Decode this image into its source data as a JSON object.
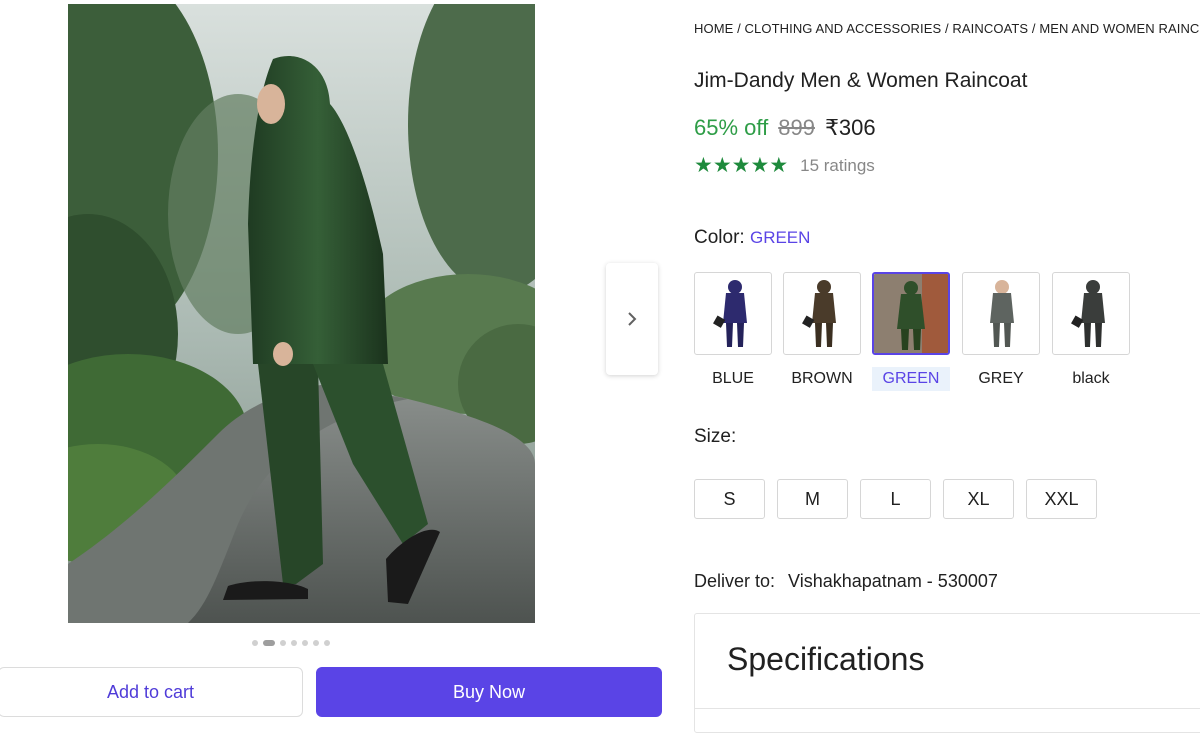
{
  "breadcrumb": [
    "HOME",
    "CLOTHING AND ACCESSORIES",
    "RAINCOATS",
    "MEN AND WOMEN RAINCOATS"
  ],
  "breadcrumb_separator": " / ",
  "product": {
    "title": "Jim-Dandy Men & Women Raincoat",
    "discount": "65% off",
    "mrp": "899",
    "price": "₹306",
    "rating_stars": 5,
    "ratings_count": "15 ratings"
  },
  "color": {
    "label": "Color:",
    "selected": "GREEN",
    "options": [
      {
        "label": "BLUE",
        "hex": "#2d2a6e"
      },
      {
        "label": "BROWN",
        "hex": "#4a3b2a"
      },
      {
        "label": "GREEN",
        "hex": "#2f4f2a"
      },
      {
        "label": "GREY",
        "hex": "#5e6460"
      },
      {
        "label": "black",
        "hex": "#3a3d3b"
      }
    ]
  },
  "size": {
    "label": "Size:",
    "options": [
      "S",
      "M",
      "L",
      "XL",
      "XXL"
    ]
  },
  "delivery": {
    "label": "Deliver to:",
    "location": "Vishakhapatnam - 530007"
  },
  "specifications": {
    "title": "Specifications"
  },
  "gallery": {
    "total_images": 8,
    "active_index": 1
  },
  "actions": {
    "add_to_cart": "Add to cart",
    "buy_now": "Buy Now"
  },
  "colors": {
    "accent": "#5a44e6",
    "discount_green": "#2e9d47",
    "star_green": "#1e8a3c"
  },
  "icons": {
    "next": "chevron-right-icon",
    "star": "star-icon"
  }
}
